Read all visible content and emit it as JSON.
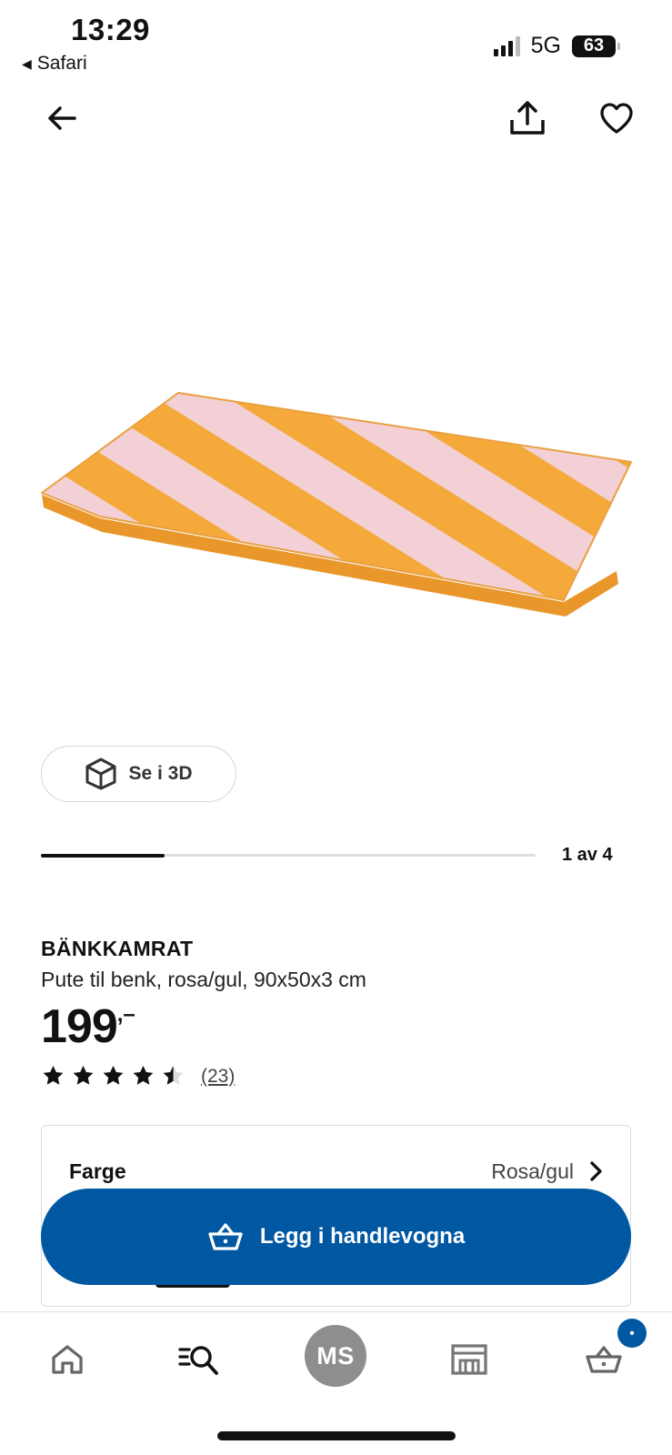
{
  "status_bar": {
    "time": "13:29",
    "back_app": "Safari",
    "network": "5G",
    "battery": "63"
  },
  "top_bar": {
    "back_icon": "arrow-left-icon",
    "share_icon": "share-icon",
    "favorite_icon": "heart-icon"
  },
  "media": {
    "image_description_icon": "striped-bench-cushion",
    "stripe_colors": [
      "#f4a93a",
      "#f3cfd6"
    ],
    "view_3d_label": "Se i 3D",
    "gallery_position": "1 av 4",
    "gallery_progress": 0.25
  },
  "product": {
    "name": "BÄNKKAMRAT",
    "description": "Pute til benk, rosa/gul, 90x50x3 cm",
    "price_integer": "199",
    "price_suffix": ",–",
    "rating_value": 4.5,
    "review_count": "(23)"
  },
  "color_selector": {
    "label": "Farge",
    "value": "Rosa/gul"
  },
  "cta": {
    "add_to_cart_label": "Legg i handlevogna"
  },
  "bottom_nav": {
    "profile_initials": "MS",
    "cart_badge": "•",
    "accent_color": "#0058a3"
  }
}
